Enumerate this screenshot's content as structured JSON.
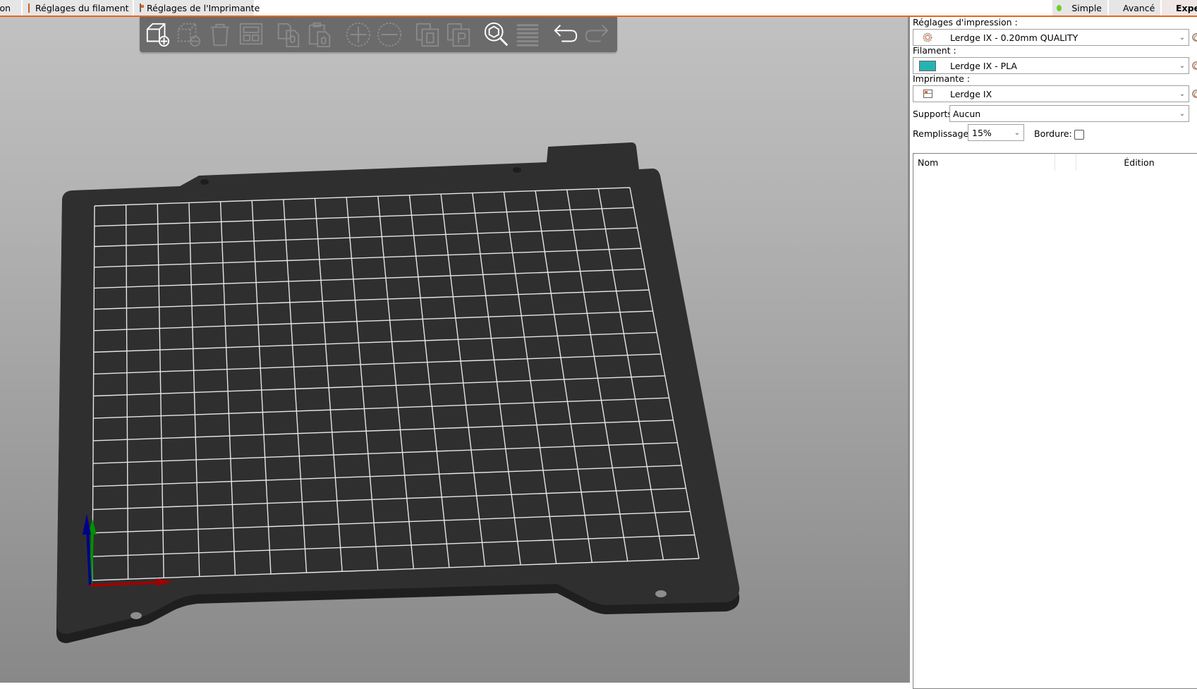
{
  "tabs": [
    {
      "label": "ion",
      "icon": "none"
    },
    {
      "label": "Réglages du filament",
      "icon": "filament-icon"
    },
    {
      "label": "Réglages de l'Imprimante",
      "icon": "printer-icon"
    }
  ],
  "modes": [
    {
      "label": "Simple",
      "color": "#6cd12a",
      "active": false
    },
    {
      "label": "Avancé",
      "color": "#ffd200",
      "active": false
    },
    {
      "label": "Expert",
      "color": "#e00000",
      "active": true
    }
  ],
  "toolbar": {
    "buttons": [
      {
        "name": "add-object",
        "enabled": true
      },
      {
        "name": "delete-object",
        "enabled": false
      },
      {
        "name": "delete-all",
        "enabled": false
      },
      {
        "name": "arrange",
        "enabled": false
      },
      {
        "name": "copy",
        "enabled": false
      },
      {
        "name": "paste",
        "enabled": false
      },
      {
        "name": "add-instance",
        "enabled": false
      },
      {
        "name": "remove-instance",
        "enabled": false
      },
      {
        "name": "split-to-objects",
        "enabled": false
      },
      {
        "name": "split-to-parts",
        "enabled": false
      },
      {
        "name": "search",
        "enabled": true
      },
      {
        "name": "layers-editing",
        "enabled": false
      },
      {
        "name": "undo",
        "enabled": true
      },
      {
        "name": "redo",
        "enabled": false
      }
    ]
  },
  "panel": {
    "print_settings_label": "Réglages d'impression :",
    "print_settings_value": "Lerdge IX - 0.20mm QUALITY",
    "filament_label": "Filament :",
    "filament_value": "Lerdge IX - PLA",
    "filament_color": "#27b2b2",
    "printer_label": "Imprimante :",
    "printer_value": "Lerdge IX",
    "supports_label": "Supports:",
    "supports_value": "Aucun",
    "infill_label": "Remplissage:",
    "infill_value": "15%",
    "brim_label": "Bordure:",
    "brim_checked": false,
    "table": {
      "columns": [
        "Nom",
        "",
        "Édition"
      ]
    }
  },
  "scene": {
    "bed_grid_columns": 17,
    "bed_grid_rows": 17,
    "axes": [
      "x",
      "y",
      "z"
    ]
  },
  "colors": {
    "accent": "#e8651e",
    "bed": "#2f2f2f",
    "grid": "#e6e6e6",
    "axis_x": "#a00000",
    "axis_y": "#009000",
    "axis_z": "#00008a"
  }
}
